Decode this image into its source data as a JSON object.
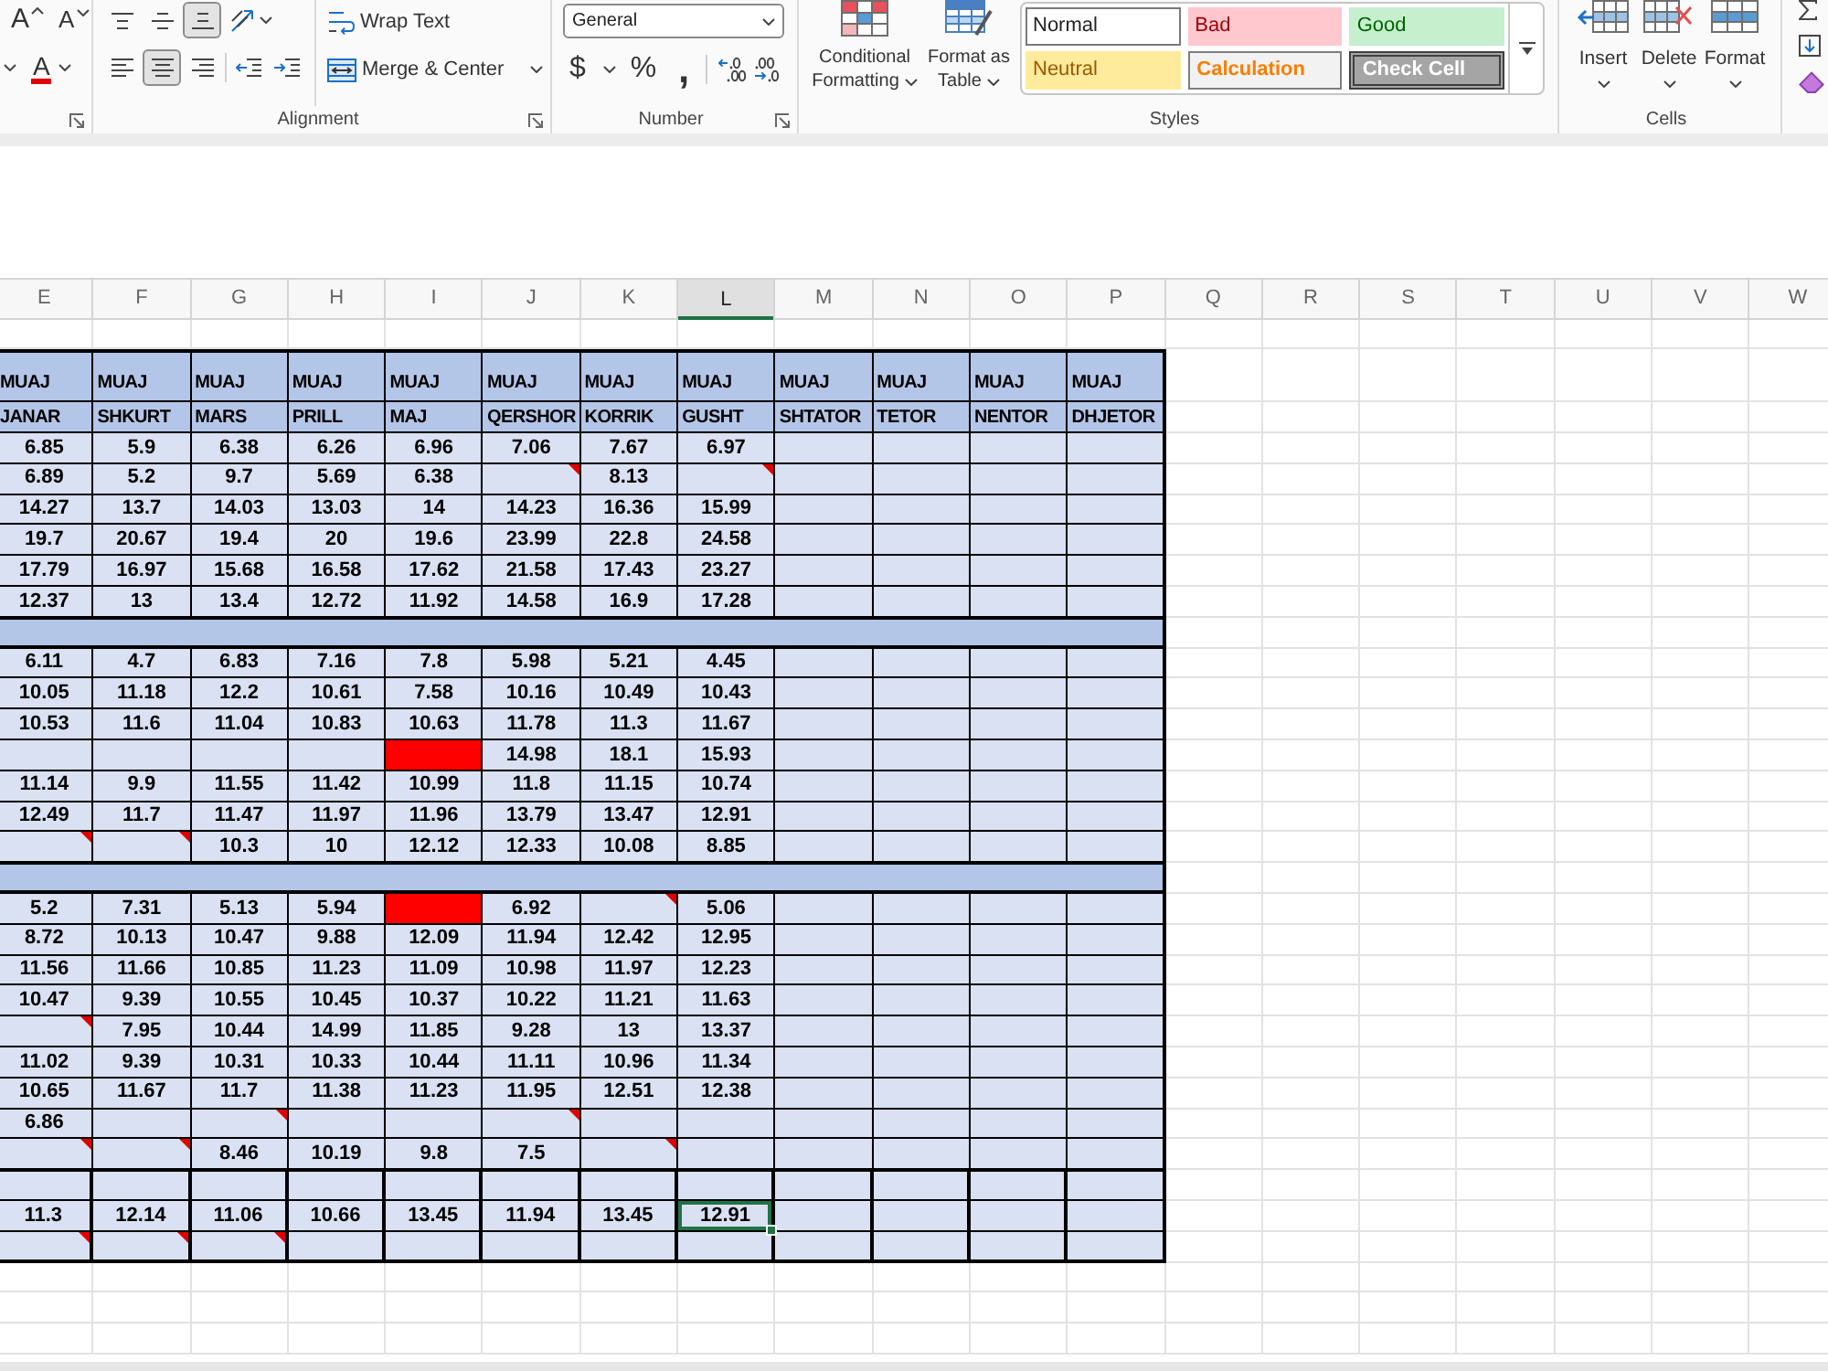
{
  "ribbon": {
    "font": {
      "buttons": [
        {
          "kind": "grow",
          "glyph": "A"
        },
        {
          "kind": "shrink",
          "glyph": "A"
        },
        {
          "kind": "color",
          "glyph": "A"
        }
      ]
    },
    "alignment": {
      "vertical": [
        {
          "kind": "top",
          "selected": false
        },
        {
          "kind": "middle",
          "selected": false
        },
        {
          "kind": "bottom",
          "selected": true
        }
      ],
      "horizontal": [
        {
          "kind": "left",
          "selected": false
        },
        {
          "kind": "center",
          "selected": true
        },
        {
          "kind": "right",
          "selected": false
        }
      ],
      "wrap_text": "Wrap Text",
      "merge": "Merge & Center",
      "label": "Alignment"
    },
    "number": {
      "format": "General",
      "currency": "$",
      "percent": "%",
      "comma": ",",
      "label": "Number"
    },
    "styles": {
      "buttons": [
        {
          "kind": "conditional",
          "lines": [
            "Conditional",
            "Formatting"
          ]
        },
        {
          "kind": "table",
          "lines": [
            "Format as",
            "Table"
          ]
        }
      ],
      "gallery": [
        {
          "kind": "normal",
          "label": "Normal",
          "selected": true
        },
        {
          "kind": "bad",
          "label": "Bad",
          "selected": false
        },
        {
          "kind": "good",
          "label": "Good",
          "selected": false
        },
        {
          "kind": "neutral",
          "label": "Neutral",
          "selected": false
        },
        {
          "kind": "calculation",
          "label": "Calculation",
          "selected": false
        },
        {
          "kind": "check",
          "label": "Check Cell",
          "selected": false
        }
      ],
      "label": "Styles"
    },
    "cells": {
      "buttons": [
        {
          "kind": "insert",
          "label": "Insert"
        },
        {
          "kind": "delete",
          "label": "Delete"
        },
        {
          "kind": "format",
          "label": "Format"
        }
      ],
      "label": "Cells"
    }
  },
  "sheet": {
    "columns": [
      {
        "label": "E",
        "selected": false
      },
      {
        "label": "F",
        "selected": false
      },
      {
        "label": "G",
        "selected": false
      },
      {
        "label": "H",
        "selected": false
      },
      {
        "label": "I",
        "selected": false
      },
      {
        "label": "J",
        "selected": false
      },
      {
        "label": "K",
        "selected": false
      },
      {
        "label": "L",
        "selected": true
      },
      {
        "label": "M",
        "selected": false
      },
      {
        "label": "N",
        "selected": false
      },
      {
        "label": "O",
        "selected": false
      },
      {
        "label": "P",
        "selected": false
      },
      {
        "label": "Q",
        "selected": false
      },
      {
        "label": "R",
        "selected": false
      },
      {
        "label": "S",
        "selected": false
      },
      {
        "label": "T",
        "selected": false
      },
      {
        "label": "U",
        "selected": false
      },
      {
        "label": "V",
        "selected": false
      },
      {
        "label": "W",
        "selected": false
      }
    ],
    "table": {
      "header_rows": [
        [
          "MUAJ",
          "MUAJ",
          "MUAJ",
          "MUAJ",
          "MUAJ",
          "MUAJ",
          "MUAJ",
          "MUAJ",
          "MUAJ",
          "MUAJ",
          "MUAJ",
          "MUAJ"
        ],
        [
          "JANAR",
          "SHKURT",
          "MARS",
          "PRILL",
          "MAJ",
          "QERSHOR",
          "KORRIK",
          "GUSHT",
          "SHTATOR",
          "TETOR",
          "NENTOR",
          "DHJETOR"
        ]
      ],
      "rows": [
        {
          "kind": "data",
          "cells": [
            {
              "text": "6.85",
              "note": false,
              "selected": false
            },
            {
              "text": "5.9",
              "note": false,
              "selected": false
            },
            {
              "text": "6.38",
              "note": false,
              "selected": false
            },
            {
              "text": "6.26",
              "note": false,
              "selected": false
            },
            {
              "text": "6.96",
              "note": false,
              "selected": false
            },
            {
              "text": "7.06",
              "note": false,
              "selected": false
            },
            {
              "text": "7.67",
              "note": false,
              "selected": false
            },
            {
              "text": "6.97",
              "note": false,
              "selected": false
            }
          ]
        },
        {
          "kind": "data",
          "cells": [
            {
              "text": "6.89",
              "note": false,
              "selected": false
            },
            {
              "text": "5.2",
              "note": false,
              "selected": false
            },
            {
              "text": "9.7",
              "note": false,
              "selected": false
            },
            {
              "text": "5.69",
              "note": false,
              "selected": false
            },
            {
              "text": "6.38",
              "note": false,
              "selected": false
            },
            {
              "note": true,
              "selected": false
            },
            {
              "text": "8.13",
              "note": false,
              "selected": false
            },
            {
              "note": true,
              "selected": false
            }
          ]
        },
        {
          "kind": "data",
          "cells": [
            {
              "text": "14.27",
              "note": false,
              "selected": false
            },
            {
              "text": "13.7",
              "note": false,
              "selected": false
            },
            {
              "text": "14.03",
              "note": false,
              "selected": false
            },
            {
              "text": "13.03",
              "note": false,
              "selected": false
            },
            {
              "text": "14",
              "note": false,
              "selected": false
            },
            {
              "text": "14.23",
              "note": false,
              "selected": false
            },
            {
              "text": "16.36",
              "note": false,
              "selected": false
            },
            {
              "text": "15.99",
              "note": false,
              "selected": false
            }
          ]
        },
        {
          "kind": "data",
          "cells": [
            {
              "text": "19.7",
              "note": false,
              "selected": false
            },
            {
              "text": "20.67",
              "note": false,
              "selected": false
            },
            {
              "text": "19.4",
              "note": false,
              "selected": false
            },
            {
              "text": "20",
              "note": false,
              "selected": false
            },
            {
              "text": "19.6",
              "note": false,
              "selected": false
            },
            {
              "text": "23.99",
              "note": false,
              "selected": false
            },
            {
              "text": "22.8",
              "note": false,
              "selected": false
            },
            {
              "text": "24.58",
              "note": false,
              "selected": false
            }
          ]
        },
        {
          "kind": "data",
          "cells": [
            {
              "text": "17.79",
              "note": false,
              "selected": false
            },
            {
              "text": "16.97",
              "note": false,
              "selected": false
            },
            {
              "text": "15.68",
              "note": false,
              "selected": false
            },
            {
              "text": "16.58",
              "note": false,
              "selected": false
            },
            {
              "text": "17.62",
              "note": false,
              "selected": false
            },
            {
              "text": "21.58",
              "note": false,
              "selected": false
            },
            {
              "text": "17.43",
              "note": false,
              "selected": false
            },
            {
              "text": "23.27",
              "note": false,
              "selected": false
            }
          ]
        },
        {
          "kind": "data",
          "cells": [
            {
              "text": "12.37",
              "note": false,
              "selected": false
            },
            {
              "text": "13",
              "note": false,
              "selected": false
            },
            {
              "text": "13.4",
              "note": false,
              "selected": false
            },
            {
              "text": "12.72",
              "note": false,
              "selected": false
            },
            {
              "text": "11.92",
              "note": false,
              "selected": false
            },
            {
              "text": "14.58",
              "note": false,
              "selected": false
            },
            {
              "text": "16.9",
              "note": false,
              "selected": false
            },
            {
              "text": "17.28",
              "note": false,
              "selected": false
            }
          ]
        },
        {
          "kind": "separator"
        },
        {
          "kind": "data",
          "cells": [
            {
              "text": "6.11",
              "note": false,
              "selected": false
            },
            {
              "text": "4.7",
              "note": false,
              "selected": false
            },
            {
              "text": "6.83",
              "note": false,
              "selected": false
            },
            {
              "text": "7.16",
              "note": false,
              "selected": false
            },
            {
              "text": "7.8",
              "note": false,
              "selected": false
            },
            {
              "text": "5.98",
              "note": false,
              "selected": false
            },
            {
              "text": "5.21",
              "note": false,
              "selected": false
            },
            {
              "text": "4.45",
              "note": false,
              "selected": false
            }
          ]
        },
        {
          "kind": "data",
          "cells": [
            {
              "text": "10.05",
              "note": false,
              "selected": false
            },
            {
              "text": "11.18",
              "note": false,
              "selected": false
            },
            {
              "text": "12.2",
              "note": false,
              "selected": false
            },
            {
              "text": "10.61",
              "note": false,
              "selected": false
            },
            {
              "text": "7.58",
              "note": false,
              "selected": false
            },
            {
              "text": "10.16",
              "note": false,
              "selected": false
            },
            {
              "text": "10.49",
              "note": false,
              "selected": false
            },
            {
              "text": "10.43",
              "note": false,
              "selected": false
            }
          ]
        },
        {
          "kind": "data",
          "cells": [
            {
              "text": "10.53",
              "note": false,
              "selected": false
            },
            {
              "text": "11.6",
              "note": false,
              "selected": false
            },
            {
              "text": "11.04",
              "note": false,
              "selected": false
            },
            {
              "text": "10.83",
              "note": false,
              "selected": false
            },
            {
              "text": "10.63",
              "note": false,
              "selected": false
            },
            {
              "text": "11.78",
              "note": false,
              "selected": false
            },
            {
              "text": "11.3",
              "note": false,
              "selected": false
            },
            {
              "text": "11.67",
              "note": false,
              "selected": false
            }
          ]
        },
        {
          "kind": "data",
          "cells": [
            {
              "note": false,
              "selected": false
            },
            {
              "note": false,
              "selected": false
            },
            {
              "note": false,
              "selected": false
            },
            {
              "note": false,
              "selected": false
            },
            {
              "color": "#ff0000",
              "note": false,
              "selected": false
            },
            {
              "text": "14.98",
              "note": false,
              "selected": false
            },
            {
              "text": "18.1",
              "note": false,
              "selected": false
            },
            {
              "text": "15.93",
              "note": false,
              "selected": false
            }
          ]
        },
        {
          "kind": "data",
          "cells": [
            {
              "text": "11.14",
              "note": false,
              "selected": false
            },
            {
              "text": "9.9",
              "note": false,
              "selected": false
            },
            {
              "text": "11.55",
              "note": false,
              "selected": false
            },
            {
              "text": "11.42",
              "note": false,
              "selected": false
            },
            {
              "text": "10.99",
              "note": false,
              "selected": false
            },
            {
              "text": "11.8",
              "note": false,
              "selected": false
            },
            {
              "text": "11.15",
              "note": false,
              "selected": false
            },
            {
              "text": "10.74",
              "note": false,
              "selected": false
            }
          ]
        },
        {
          "kind": "data",
          "cells": [
            {
              "text": "12.49",
              "note": false,
              "selected": false
            },
            {
              "text": "11.7",
              "note": false,
              "selected": false
            },
            {
              "text": "11.47",
              "note": false,
              "selected": false
            },
            {
              "text": "11.97",
              "note": false,
              "selected": false
            },
            {
              "text": "11.96",
              "note": false,
              "selected": false
            },
            {
              "text": "13.79",
              "note": false,
              "selected": false
            },
            {
              "text": "13.47",
              "note": false,
              "selected": false
            },
            {
              "text": "12.91",
              "note": false,
              "selected": false
            }
          ]
        },
        {
          "kind": "data",
          "cells": [
            {
              "note": true,
              "selected": false
            },
            {
              "note": true,
              "selected": false
            },
            {
              "text": "10.3",
              "note": false,
              "selected": false
            },
            {
              "text": "10",
              "note": false,
              "selected": false
            },
            {
              "text": "12.12",
              "note": false,
              "selected": false
            },
            {
              "text": "12.33",
              "note": false,
              "selected": false
            },
            {
              "text": "10.08",
              "note": false,
              "selected": false
            },
            {
              "text": "8.85",
              "note": false,
              "selected": false
            }
          ]
        },
        {
          "kind": "separator"
        },
        {
          "kind": "data",
          "cells": [
            {
              "text": "5.2",
              "note": false,
              "selected": false
            },
            {
              "text": "7.31",
              "note": false,
              "selected": false
            },
            {
              "text": "5.13",
              "note": false,
              "selected": false
            },
            {
              "text": "5.94",
              "note": false,
              "selected": false
            },
            {
              "color": "#ff0000",
              "note": false,
              "selected": false
            },
            {
              "text": "6.92",
              "note": false,
              "selected": false
            },
            {
              "note": true,
              "selected": false
            },
            {
              "text": "5.06",
              "note": false,
              "selected": false
            }
          ]
        },
        {
          "kind": "data",
          "cells": [
            {
              "text": "8.72",
              "note": false,
              "selected": false
            },
            {
              "text": "10.13",
              "note": false,
              "selected": false
            },
            {
              "text": "10.47",
              "note": false,
              "selected": false
            },
            {
              "text": "9.88",
              "note": false,
              "selected": false
            },
            {
              "text": "12.09",
              "note": false,
              "selected": false
            },
            {
              "text": "11.94",
              "note": false,
              "selected": false
            },
            {
              "text": "12.42",
              "note": false,
              "selected": false
            },
            {
              "text": "12.95",
              "note": false,
              "selected": false
            }
          ]
        },
        {
          "kind": "data",
          "cells": [
            {
              "text": "11.56",
              "note": false,
              "selected": false
            },
            {
              "text": "11.66",
              "note": false,
              "selected": false
            },
            {
              "text": "10.85",
              "note": false,
              "selected": false
            },
            {
              "text": "11.23",
              "note": false,
              "selected": false
            },
            {
              "text": "11.09",
              "note": false,
              "selected": false
            },
            {
              "text": "10.98",
              "note": false,
              "selected": false
            },
            {
              "text": "11.97",
              "note": false,
              "selected": false
            },
            {
              "text": "12.23",
              "note": false,
              "selected": false
            }
          ]
        },
        {
          "kind": "data",
          "cells": [
            {
              "text": "10.47",
              "note": false,
              "selected": false
            },
            {
              "text": "9.39",
              "note": false,
              "selected": false
            },
            {
              "text": "10.55",
              "note": false,
              "selected": false
            },
            {
              "text": "10.45",
              "note": false,
              "selected": false
            },
            {
              "text": "10.37",
              "note": false,
              "selected": false
            },
            {
              "text": "10.22",
              "note": false,
              "selected": false
            },
            {
              "text": "11.21",
              "note": false,
              "selected": false
            },
            {
              "text": "11.63",
              "note": false,
              "selected": false
            }
          ]
        },
        {
          "kind": "data",
          "cells": [
            {
              "note": true,
              "selected": false
            },
            {
              "text": "7.95",
              "note": false,
              "selected": false
            },
            {
              "text": "10.44",
              "note": false,
              "selected": false
            },
            {
              "text": "14.99",
              "note": false,
              "selected": false
            },
            {
              "text": "11.85",
              "note": false,
              "selected": false
            },
            {
              "text": "9.28",
              "note": false,
              "selected": false
            },
            {
              "text": "13",
              "note": false,
              "selected": false
            },
            {
              "text": "13.37",
              "note": false,
              "selected": false
            }
          ]
        },
        {
          "kind": "data",
          "cells": [
            {
              "text": "11.02",
              "note": false,
              "selected": false
            },
            {
              "text": "9.39",
              "note": false,
              "selected": false
            },
            {
              "text": "10.31",
              "note": false,
              "selected": false
            },
            {
              "text": "10.33",
              "note": false,
              "selected": false
            },
            {
              "text": "10.44",
              "note": false,
              "selected": false
            },
            {
              "text": "11.11",
              "note": false,
              "selected": false
            },
            {
              "text": "10.96",
              "note": false,
              "selected": false
            },
            {
              "text": "11.34",
              "note": false,
              "selected": false
            }
          ]
        },
        {
          "kind": "data",
          "cells": [
            {
              "text": "10.65",
              "note": false,
              "selected": false
            },
            {
              "text": "11.67",
              "note": false,
              "selected": false
            },
            {
              "text": "11.7",
              "note": false,
              "selected": false
            },
            {
              "text": "11.38",
              "note": false,
              "selected": false
            },
            {
              "text": "11.23",
              "note": false,
              "selected": false
            },
            {
              "text": "11.95",
              "note": false,
              "selected": false
            },
            {
              "text": "12.51",
              "note": false,
              "selected": false
            },
            {
              "text": "12.38",
              "note": false,
              "selected": false
            }
          ]
        },
        {
          "kind": "data",
          "cells": [
            {
              "text": "6.86",
              "note": false,
              "selected": false
            },
            {
              "note": false,
              "selected": false
            },
            {
              "note": true,
              "selected": false
            },
            {
              "note": false,
              "selected": false
            },
            {
              "note": false,
              "selected": false
            },
            {
              "note": true,
              "selected": false
            },
            {
              "note": false,
              "selected": false
            },
            {
              "note": false,
              "selected": false
            }
          ]
        },
        {
          "kind": "data",
          "cells": [
            {
              "note": true,
              "selected": false
            },
            {
              "note": true,
              "selected": false
            },
            {
              "text": "8.46",
              "note": false,
              "selected": false
            },
            {
              "text": "10.19",
              "note": false,
              "selected": false
            },
            {
              "text": "9.8",
              "note": false,
              "selected": false
            },
            {
              "text": "7.5",
              "note": false,
              "selected": false
            },
            {
              "note": true,
              "selected": false
            },
            {
              "note": false,
              "selected": false
            }
          ]
        },
        {
          "kind": "total",
          "cells": [
            {
              "note": false,
              "selected": false
            },
            {
              "note": false,
              "selected": false
            },
            {
              "note": false,
              "selected": false
            },
            {
              "note": false,
              "selected": false
            },
            {
              "note": false,
              "selected": false
            },
            {
              "note": false,
              "selected": false
            },
            {
              "note": false,
              "selected": false
            },
            {
              "note": false,
              "selected": false
            }
          ]
        },
        {
          "kind": "total",
          "cells": [
            {
              "text": "11.3",
              "note": false,
              "selected": false
            },
            {
              "text": "12.14",
              "note": false,
              "selected": false
            },
            {
              "text": "11.06",
              "note": false,
              "selected": false
            },
            {
              "text": "10.66",
              "note": false,
              "selected": false
            },
            {
              "text": "13.45",
              "note": false,
              "selected": false
            },
            {
              "text": "11.94",
              "note": false,
              "selected": false
            },
            {
              "text": "13.45",
              "note": false,
              "selected": false
            },
            {
              "text": "12.91",
              "note": false,
              "selected": true
            }
          ]
        },
        {
          "kind": "total",
          "cells": [
            {
              "note": true,
              "selected": false
            },
            {
              "note": true,
              "selected": false
            },
            {
              "note": true,
              "selected": false
            },
            {
              "note": false,
              "selected": false
            },
            {
              "note": false,
              "selected": false
            },
            {
              "note": false,
              "selected": false
            },
            {
              "note": false,
              "selected": false
            },
            {
              "note": false,
              "selected": false
            }
          ]
        }
      ]
    }
  }
}
